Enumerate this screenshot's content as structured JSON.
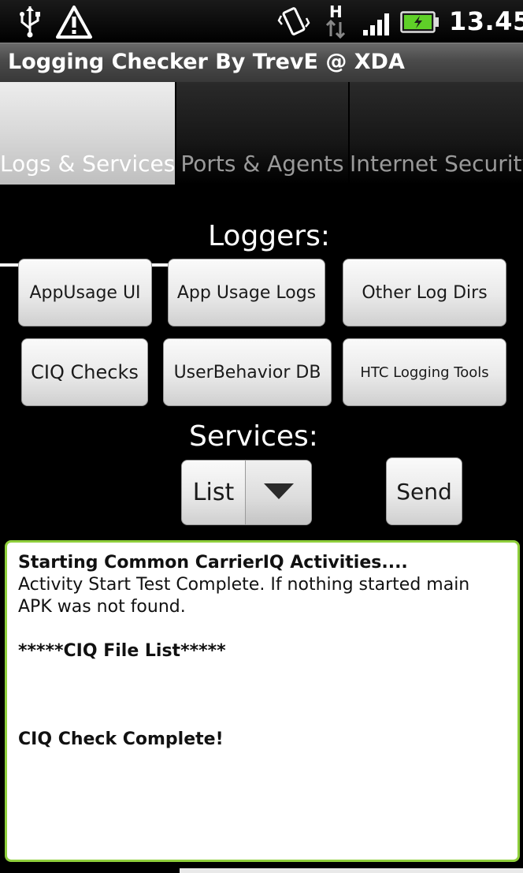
{
  "status_bar": {
    "time": "13.45",
    "icons": [
      "usb-icon",
      "warning-icon",
      "vibrate-icon",
      "hspa-data-icon",
      "signal-icon",
      "battery-charging-icon"
    ],
    "network_type": "H",
    "battery_color": "#5fd028"
  },
  "app": {
    "title": "Logging Checker By TrevE @ XDA"
  },
  "tabs": [
    {
      "label": "Logs & Services",
      "selected": true
    },
    {
      "label": "Ports & Agents",
      "selected": false
    },
    {
      "label": "Internet Security",
      "selected": false
    }
  ],
  "loggers": {
    "heading": "Loggers:",
    "buttons": [
      "AppUsage UI",
      "App Usage Logs",
      "Other Log Dirs",
      "CIQ Checks",
      "UserBehavior DB",
      "HTC Logging Tools"
    ]
  },
  "services": {
    "heading": "Services:",
    "spinner_value": "List",
    "send_label": "Send"
  },
  "output": {
    "accent_color": "#8fcf3c",
    "lines": [
      {
        "text": "Starting Common CarrierIQ Activities....",
        "bold": true
      },
      {
        "text": "Activity Start Test Complete. If nothing started main APK was not found.",
        "bold": false
      },
      {
        "text": "",
        "bold": false
      },
      {
        "text": "*****CIQ File List*****",
        "bold": true
      },
      {
        "text": "",
        "bold": false
      },
      {
        "text": "",
        "bold": false
      },
      {
        "text": "",
        "bold": false
      },
      {
        "text": "CIQ Check Complete!",
        "bold": true
      }
    ]
  }
}
